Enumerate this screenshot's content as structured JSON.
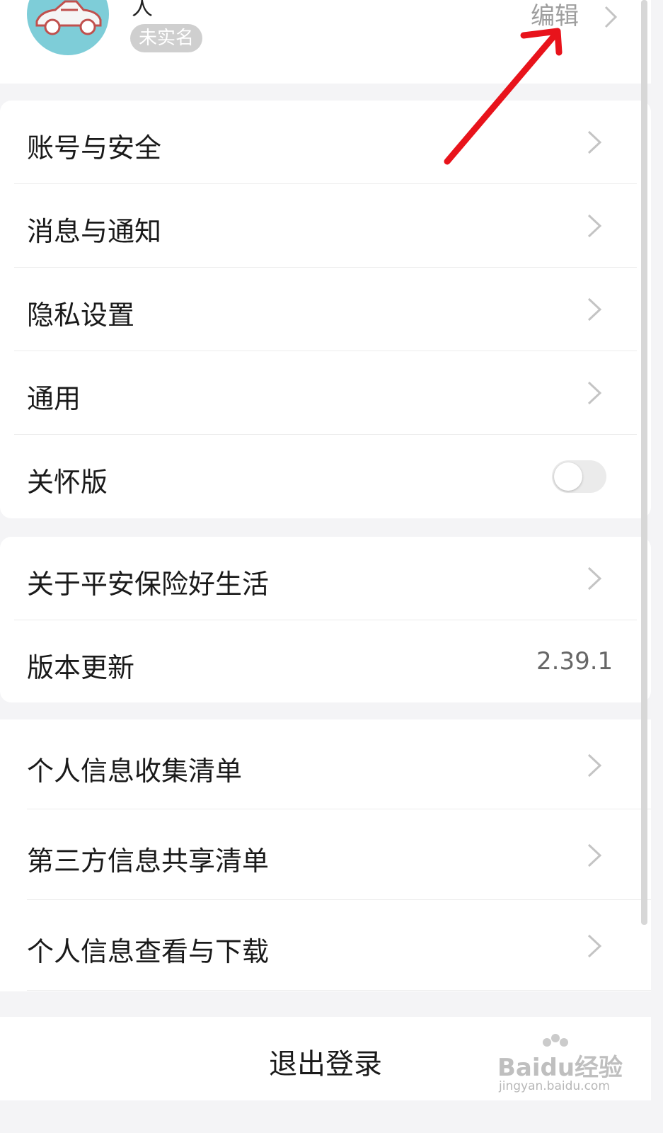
{
  "profile": {
    "name_fragment": "人",
    "badge": "未实名",
    "edit_label": "编辑"
  },
  "settings_group_1": [
    {
      "label": "账号与安全"
    },
    {
      "label": "消息与通知"
    },
    {
      "label": "隐私设置"
    },
    {
      "label": "通用"
    },
    {
      "label": "关怀版",
      "toggle": false
    }
  ],
  "settings_group_2": [
    {
      "label": "关于平安保险好生活"
    },
    {
      "label": "版本更新",
      "value": "2.39.1"
    }
  ],
  "settings_group_3": [
    {
      "label": "个人信息收集清单"
    },
    {
      "label": "第三方信息共享清单"
    },
    {
      "label": "个人信息查看与下载"
    }
  ],
  "logout_label": "退出登录",
  "watermark": {
    "main": "Baidu经验",
    "sub": "jingyan.baidu.com"
  },
  "colors": {
    "background": "#f4f4f6",
    "avatar": "#7ecdd8",
    "annotation_arrow": "#e8131b",
    "chevron": "#c4c4c4"
  }
}
